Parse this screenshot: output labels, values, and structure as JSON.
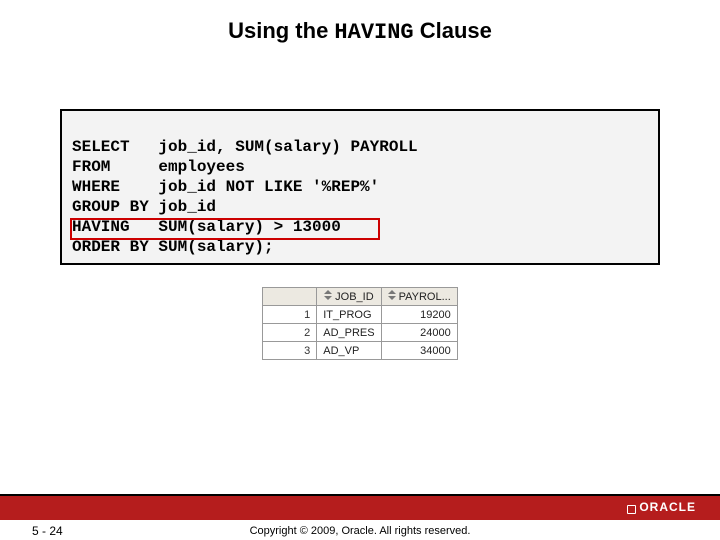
{
  "title": {
    "pre": "Using the ",
    "mono": "HAVING",
    "post": " Clause"
  },
  "sql": {
    "lines": [
      {
        "kw": "SELECT",
        "rest": "job_id, SUM(salary) PAYROLL"
      },
      {
        "kw": "FROM",
        "rest": "employees"
      },
      {
        "kw": "WHERE",
        "rest": "job_id NOT LIKE '%REP%'"
      },
      {
        "kw": "GROUP BY",
        "rest": "job_id"
      },
      {
        "kw": "HAVING",
        "rest": "SUM(salary) > 13000"
      },
      {
        "kw": "ORDER BY",
        "rest": "SUM(salary);"
      }
    ],
    "highlight_line_index": 4
  },
  "chart_data": {
    "type": "table",
    "columns": [
      "",
      "JOB_ID",
      "PAYROL..."
    ],
    "rows": [
      {
        "n": "1",
        "job_id": "IT_PROG",
        "payroll": "19200"
      },
      {
        "n": "2",
        "job_id": "AD_PRES",
        "payroll": "24000"
      },
      {
        "n": "3",
        "job_id": "AD_VP",
        "payroll": "34000"
      }
    ]
  },
  "footer": {
    "page": "5 - 24",
    "copyright": "Copyright © 2009, Oracle. All rights reserved.",
    "logo": "ORACLE"
  }
}
